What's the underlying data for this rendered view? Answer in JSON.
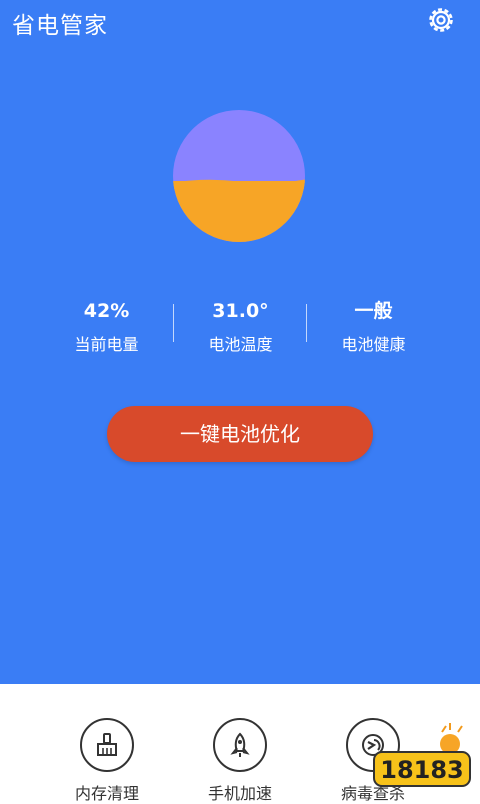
{
  "header": {
    "title": "省电管家"
  },
  "battery": {
    "level_percent": 42,
    "top_color": "#8a83ff",
    "fill_color": "#f7a526"
  },
  "stats": [
    {
      "value": "42%",
      "label": "当前电量"
    },
    {
      "value": "31.0°",
      "label": "电池温度"
    },
    {
      "value": "一般",
      "label": "电池健康"
    }
  ],
  "cta": {
    "label": "一键电池优化"
  },
  "tools": [
    {
      "label": "内存清理",
      "icon": "broom-icon"
    },
    {
      "label": "手机加速",
      "icon": "rocket-icon"
    },
    {
      "label": "病毒查杀",
      "icon": "shield-scan-icon"
    }
  ],
  "watermark": {
    "text": "18183"
  },
  "colors": {
    "background": "#3a7df5",
    "button": "#d84a2b"
  }
}
